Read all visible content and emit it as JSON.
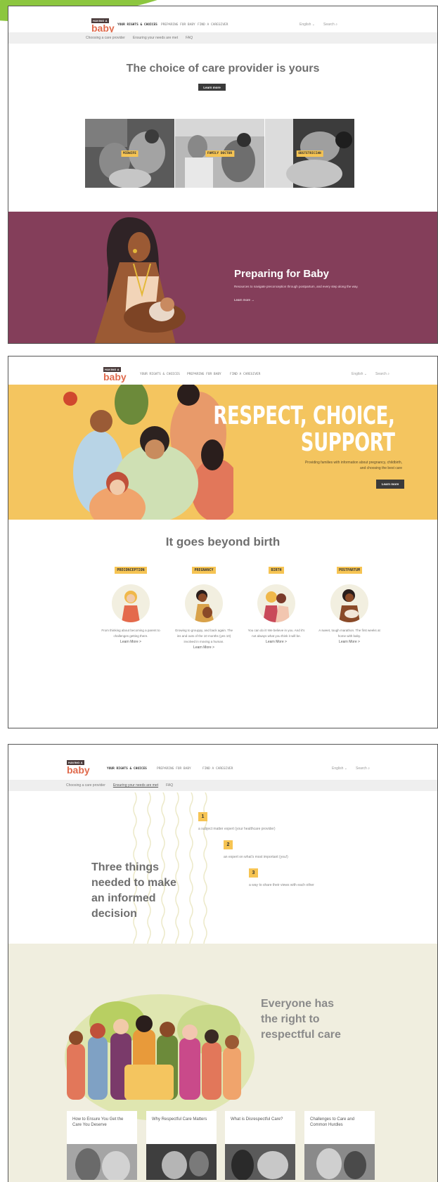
{
  "brand": {
    "top": "HAVING A",
    "bottom": "baby"
  },
  "nav": {
    "items": [
      "YOUR RIGHTS & CHOICES",
      "PREPARING FOR BABY",
      "FIND A CAREGIVER"
    ],
    "language": "English",
    "search": "Search"
  },
  "screen1": {
    "subnav": [
      "Choosing a care provider",
      "Ensuring your needs are met",
      "FAQ"
    ],
    "title": "The choice of care provider is yours",
    "button": "Learn more",
    "providers": [
      "MIDWIFE",
      "FAMILY DOCTOR",
      "OBSTETRICIAN"
    ],
    "promo": {
      "title": "Preparing for Baby",
      "text": "Resources to navigate preconception through postpartum, and every step along the way.",
      "link": "Learn more →"
    }
  },
  "screen2": {
    "hero": {
      "line1": "RESPECT, CHOICE,",
      "line2": "SUPPORT",
      "text": "Providing families with information about pregnancy, childbirth, and choosing the best care",
      "button": "Learn more"
    },
    "section_title": "It goes beyond birth",
    "stages": [
      {
        "tag": "PRECONCEPTION",
        "text": "From thinking about becoming a parent to challenges getting there.",
        "link": "Learn More >"
      },
      {
        "tag": "PREGNANCY",
        "text": "Growing to grouppy, and back again. The ins and outs of the 10 months (yes 10) involved in moving a human.",
        "link": "Learn More >"
      },
      {
        "tag": "BIRTH",
        "text": "You can do it! We believe in you. And it's not always what you think it will be.",
        "link": "Learn More >"
      },
      {
        "tag": "POSTPARTUM",
        "text": "A sweet, tough marathon. The first weeks at home with baby.",
        "link": "Learn More >"
      }
    ]
  },
  "screen3": {
    "subnav": [
      "Choosing a care provider",
      "Ensuring your needs are met",
      "FAQ"
    ],
    "heading": [
      "Three things",
      "needed to make",
      "an informed",
      "decision"
    ],
    "steps": [
      {
        "num": "1",
        "text": "a subject matter expert (your healthcare provider)"
      },
      {
        "num": "2",
        "text": "an expert on what's most important (you!)"
      },
      {
        "num": "3",
        "text": "a way to share their views with each other"
      }
    ],
    "respect_title": [
      "Everyone has",
      "the right to",
      "respectful care"
    ],
    "cards": [
      "How to Ensure You Get the Care You Deserve",
      "Why Respectful Care Matters",
      "What is Disrespectful Care?",
      "Challenges to Care and Common Hurdles"
    ]
  }
}
